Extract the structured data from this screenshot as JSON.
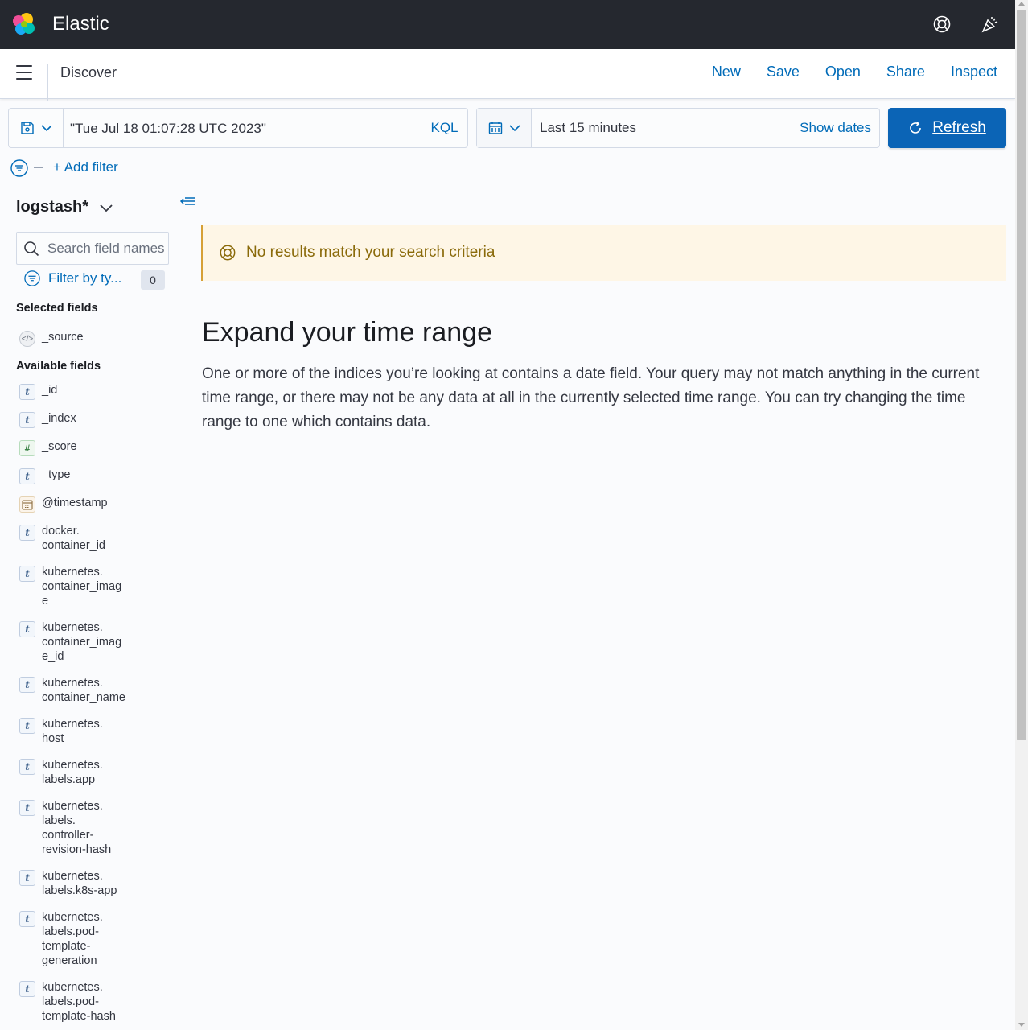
{
  "header": {
    "brand": "Elastic"
  },
  "subheader": {
    "title": "Discover",
    "nav": [
      "New",
      "Save",
      "Open",
      "Share",
      "Inspect"
    ]
  },
  "query": {
    "value": "\"Tue Jul 18 01:07:28 UTC 2023\"",
    "language": "KQL"
  },
  "time": {
    "range": "Last 15 minutes",
    "show_dates": "Show dates",
    "refresh": "Refresh"
  },
  "filters": {
    "add_filter": "+ Add filter"
  },
  "sidebar": {
    "index_pattern": "logstash*",
    "search_placeholder": "Search field names",
    "filter_by_type": "Filter by ty...",
    "filter_count": "0",
    "selected_title": "Selected fields",
    "selected_fields": [
      {
        "name": "_source",
        "type": "source"
      }
    ],
    "available_title": "Available fields",
    "available_fields": [
      {
        "name": "_id",
        "type": "string"
      },
      {
        "name": "_index",
        "type": "string"
      },
      {
        "name": "_score",
        "type": "number"
      },
      {
        "name": "_type",
        "type": "string"
      },
      {
        "name": "@timestamp",
        "type": "date"
      },
      {
        "name": "docker.\ncontainer_id",
        "type": "string"
      },
      {
        "name": "kubernetes.\ncontainer_imag\ne",
        "type": "string"
      },
      {
        "name": "kubernetes.\ncontainer_imag\ne_id",
        "type": "string"
      },
      {
        "name": "kubernetes.\ncontainer_name",
        "type": "string"
      },
      {
        "name": "kubernetes.\nhost",
        "type": "string"
      },
      {
        "name": "kubernetes.\nlabels.app",
        "type": "string"
      },
      {
        "name": "kubernetes.\nlabels.\ncontroller-\nrevision-hash",
        "type": "string"
      },
      {
        "name": "kubernetes.\nlabels.k8s-app",
        "type": "string"
      },
      {
        "name": "kubernetes.\nlabels.pod-\ntemplate-\ngeneration",
        "type": "string"
      },
      {
        "name": "kubernetes.\nlabels.pod-\ntemplate-hash",
        "type": "string"
      }
    ]
  },
  "main": {
    "callout": "No results match your search criteria",
    "empty_title": "Expand your time range",
    "empty_body": "One or more of the indices you’re looking at contains a date field. Your query may not match anything in the current time range, or there may not be any data at all in the currently selected time range. You can try changing the time range to one which contains data."
  },
  "colors": {
    "header_bg": "#25282f",
    "link": "#006bb8",
    "primary": "#0b64b6",
    "callout_bg": "#fef6e6",
    "callout_text": "#8a6a0a"
  }
}
